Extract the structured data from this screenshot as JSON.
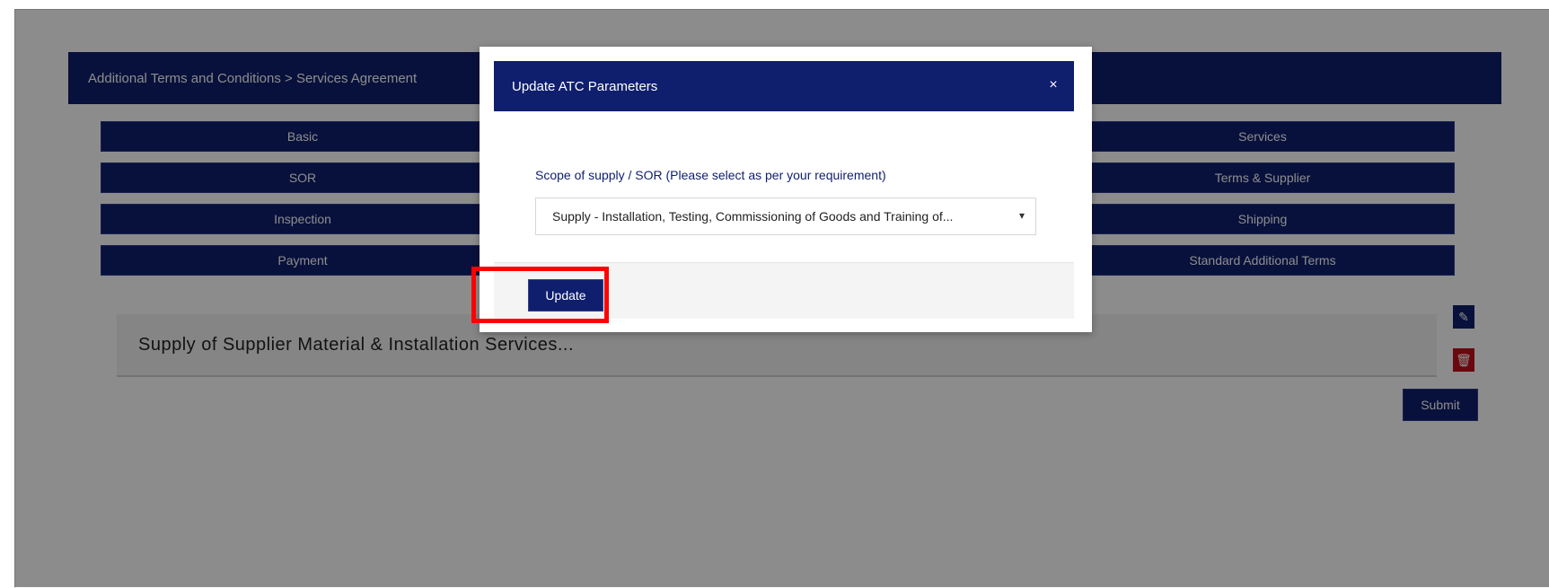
{
  "page": {
    "header_title": "Additional Terms and Conditions > Services Agreement",
    "menu": [
      {
        "left": "Basic",
        "right": "Services"
      },
      {
        "left": "SOR",
        "right": "Terms & Supplier"
      },
      {
        "left": "Inspection",
        "right": "Shipping"
      },
      {
        "left": "Payment",
        "right": "Standard Additional Terms"
      }
    ],
    "list_item": "Supply of Supplier Material & Installation Services...",
    "submit_label": "Submit",
    "edit_icon": "pencil-icon",
    "delete_icon": "trash-icon"
  },
  "modal": {
    "title": "Update ATC Parameters",
    "close_icon": "close-icon",
    "field_label": "Scope of supply / SOR (Please select as per your requirement)",
    "select_value": "Supply - Installation, Testing, Commissioning of Goods and Training of...",
    "update_label": "Update",
    "close_symbol": "×",
    "caret_symbol": "▾"
  },
  "highlight": {
    "color": "#ff0000",
    "target": "update-button"
  }
}
